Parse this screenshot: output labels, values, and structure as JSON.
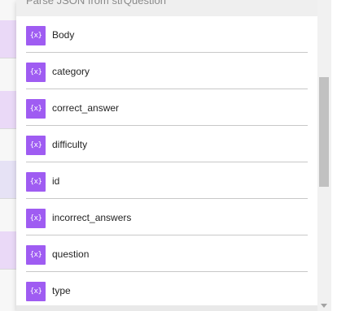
{
  "dropdown": {
    "header_text": "Parse JSON from strQuestion",
    "token_icon_glyph": "{x}",
    "token_color": "#9f5cf2",
    "items": [
      {
        "label": "Body"
      },
      {
        "label": "category"
      },
      {
        "label": "correct_answer"
      },
      {
        "label": "difficulty"
      },
      {
        "label": "id"
      },
      {
        "label": "incorrect_answers"
      },
      {
        "label": "question"
      },
      {
        "label": "type"
      }
    ]
  }
}
